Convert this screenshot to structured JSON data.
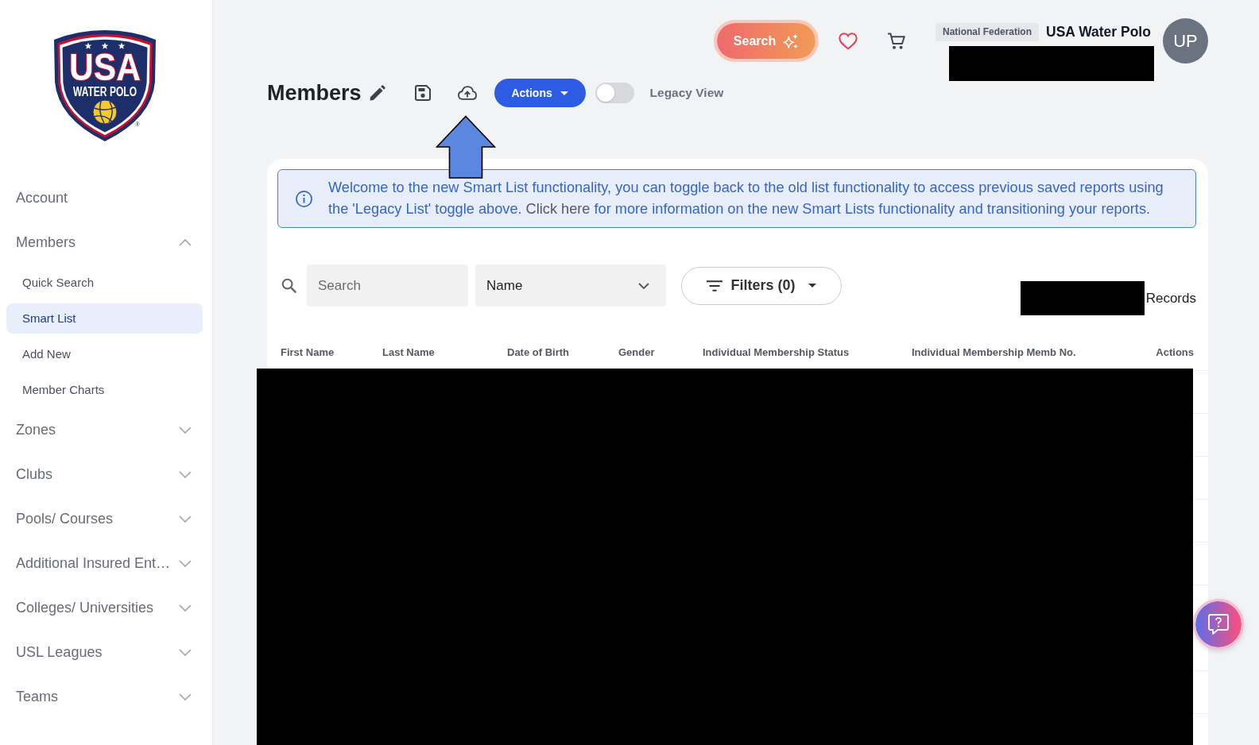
{
  "sidebar": {
    "logo": {
      "wordmark": "USA",
      "subtitle": "WATER POLO",
      "mark": "®"
    },
    "items": [
      {
        "label": "Account",
        "kind": "link"
      },
      {
        "label": "Members",
        "kind": "group",
        "expanded": true,
        "children": [
          {
            "label": "Quick Search",
            "selected": false
          },
          {
            "label": "Smart List",
            "selected": true
          },
          {
            "label": "Add New",
            "selected": false
          },
          {
            "label": "Member Charts",
            "selected": false
          }
        ]
      },
      {
        "label": "Zones",
        "kind": "group",
        "expanded": false
      },
      {
        "label": "Clubs",
        "kind": "group",
        "expanded": false
      },
      {
        "label": "Pools/ Courses",
        "kind": "group",
        "expanded": false
      },
      {
        "label": "Additional Insured Ent…",
        "kind": "group",
        "expanded": false
      },
      {
        "label": "Colleges/ Universities",
        "kind": "group",
        "expanded": false
      },
      {
        "label": "USL Leagues",
        "kind": "group",
        "expanded": false
      },
      {
        "label": "Teams",
        "kind": "group",
        "expanded": false
      }
    ]
  },
  "header": {
    "search_button": {
      "label": "Search"
    },
    "organization": {
      "badge": "National Federation",
      "name": "USA Water Polo"
    },
    "avatar": {
      "initials": "UP"
    }
  },
  "page": {
    "title": "Members",
    "actions_button": {
      "label": "Actions"
    },
    "legacy_toggle": {
      "label": "Legacy View",
      "on": false
    }
  },
  "notice": {
    "text_before": "Welcome to the new Smart List functionality, you can toggle back to the old list functionality to access previous saved reports using the 'Legacy List' toggle above.",
    "link": "Click here",
    "text_after": "for more information on the new Smart Lists functionality and transitioning your reports."
  },
  "filters": {
    "search": {
      "placeholder": "Search"
    },
    "sort_select": {
      "value": "Name"
    },
    "filters_button": {
      "label": "Filters (0)"
    },
    "records_label": "Records"
  },
  "table": {
    "columns": [
      "First Name",
      "Last Name",
      "Date of Birth",
      "Gender",
      "Individual Membership Status",
      "Individual Membership Memb No.",
      "Actions"
    ]
  }
}
